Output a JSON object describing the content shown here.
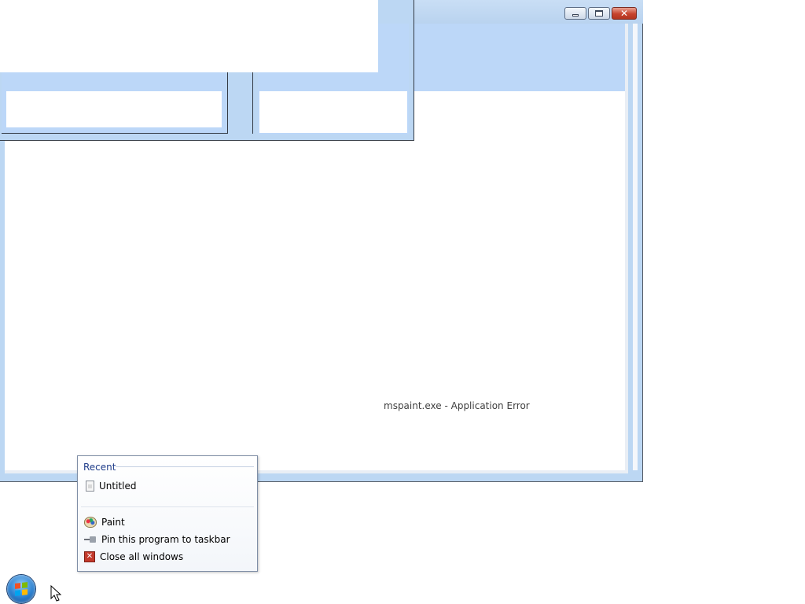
{
  "background_window": {
    "status_text": "mspaint.exe - Application Error",
    "caption_buttons": {
      "minimize_icon": "minimize-icon",
      "maximize_icon": "maximize-icon",
      "close_icon": "close-icon",
      "close_glyph": "✕"
    }
  },
  "jump_list": {
    "section_title": "Recent",
    "recent_items": [
      {
        "label": "Untitled",
        "icon": "document-icon"
      }
    ],
    "tasks": [
      {
        "label": "Paint",
        "icon": "paint-icon"
      },
      {
        "label": "Pin this program to taskbar",
        "icon": "pin-icon"
      },
      {
        "label": "Close all windows",
        "icon": "close-all-icon",
        "glyph": "✕"
      }
    ]
  },
  "taskbar": {
    "start_button_icon": "windows-logo-icon"
  },
  "colors": {
    "window_frame": "#bcd7f3",
    "close_button": "#c7432e",
    "section_title": "#1e3c8a"
  }
}
